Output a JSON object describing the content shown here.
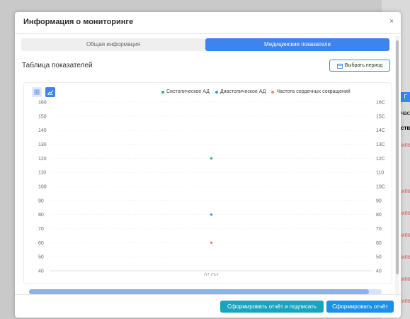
{
  "background": {
    "fragments": [
      "Г",
      "час",
      "ств",
      "ипе",
      "ипе",
      "ипе",
      "ипе",
      "ипе",
      "ипе",
      "ипе"
    ]
  },
  "modal": {
    "title": "Информация о мониторинге",
    "close_glyph": "×"
  },
  "tabs": [
    {
      "label": "Общая информация",
      "active": false
    },
    {
      "label": "Медицинские показатели",
      "active": true
    }
  ],
  "section": {
    "title": "Таблица показателей",
    "period_button": "Выбрать период"
  },
  "legend": [
    {
      "label": "Систолическое АД",
      "color": "#27b88b"
    },
    {
      "label": "Диастолическое АД",
      "color": "#2ea3d8"
    },
    {
      "label": "Частота сердечных сокращений",
      "color": "#f08a7a"
    }
  ],
  "chart_data": {
    "type": "scatter",
    "categories": [
      "07 Oct"
    ],
    "series": [
      {
        "name": "Систолическое АД",
        "values": [
          120
        ],
        "color": "#27b88b"
      },
      {
        "name": "Диастолическое АД",
        "values": [
          80
        ],
        "color": "#2ea3d8"
      },
      {
        "name": "Частота сердечных сокращений",
        "values": [
          60
        ],
        "color": "#f08a7a"
      }
    ],
    "y_ticks_left": [
      "160",
      "150",
      "140",
      "130",
      "120",
      "110",
      "100",
      "90",
      "80",
      "70",
      "60",
      "50",
      "40"
    ],
    "y_ticks_right": [
      "16C",
      "15C",
      "14C",
      "13C",
      "12C",
      "110",
      "10C",
      "90",
      "80",
      "70",
      "60",
      "50",
      "40"
    ],
    "ylim": [
      40,
      160
    ],
    "grid": true
  },
  "footer": {
    "sign_button": "Сформировать отчёт и подписать",
    "report_button": "Сформировать отчёт"
  }
}
